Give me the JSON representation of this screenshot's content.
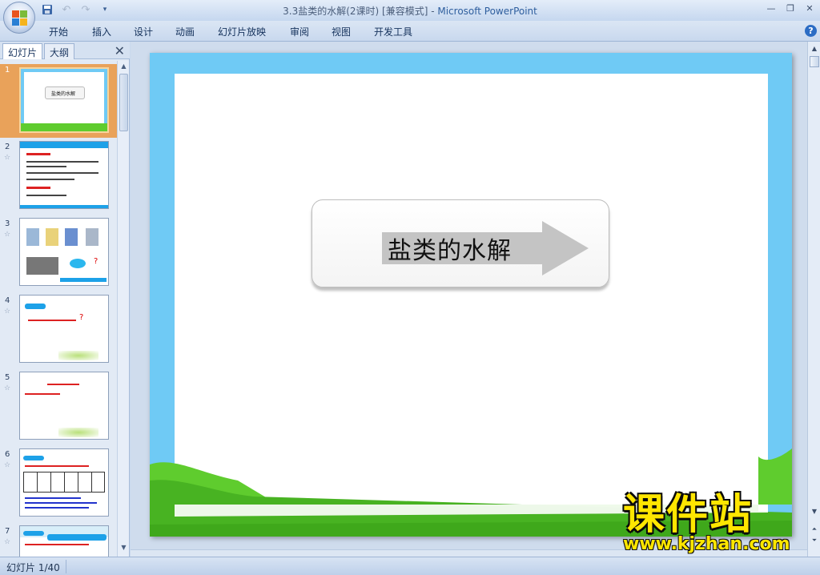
{
  "window": {
    "title": "3.3盐类的水解(2课时) [兼容模式] - ",
    "app_name": "Microsoft PowerPoint"
  },
  "ribbon_tabs": [
    "开始",
    "插入",
    "设计",
    "动画",
    "幻灯片放映",
    "审阅",
    "视图",
    "开发工具"
  ],
  "left_panel": {
    "tab_slides": "幻灯片",
    "tab_outline": "大纲",
    "thumbnails": [
      {
        "num": "1",
        "label": "盐类的水解"
      },
      {
        "num": "2",
        "label": ""
      },
      {
        "num": "3",
        "label": ""
      },
      {
        "num": "4",
        "label": ""
      },
      {
        "num": "5",
        "label": ""
      },
      {
        "num": "6",
        "label": ""
      },
      {
        "num": "7",
        "label": ""
      }
    ]
  },
  "slide": {
    "title": "盐类的水解"
  },
  "status": {
    "slide_counter": "幻灯片 1/40"
  },
  "watermark": {
    "brand": "课件站",
    "url": "www.kjzhan.com"
  },
  "colors": {
    "slide_border_blue": "#6fcaf5",
    "grass_green": "#5fcc2e",
    "selected_thumb": "#e9a25a",
    "watermark_yellow": "#ffe600"
  }
}
